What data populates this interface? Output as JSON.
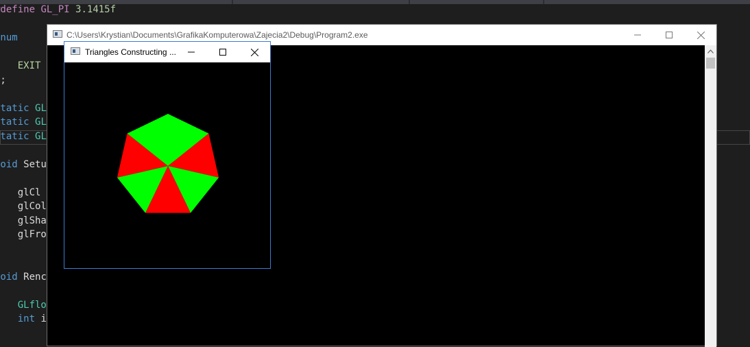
{
  "editor": {
    "lines": [
      {
        "segs": [
          {
            "t": "#define ",
            "c": "mac"
          },
          {
            "t": "GL_PI",
            "c": "mac"
          },
          {
            "t": " ",
            "c": ""
          },
          {
            "t": "3.1415f",
            "c": "num"
          }
        ]
      },
      {
        "segs": []
      },
      {
        "segs": [
          {
            "t": "enum",
            "c": "kw"
          }
        ]
      },
      {
        "segs": [
          {
            "t": "{",
            "c": ""
          }
        ]
      },
      {
        "segs": [
          {
            "t": "    ",
            "c": ""
          },
          {
            "t": "EXIT",
            "c": "en"
          }
        ]
      },
      {
        "segs": [
          {
            "t": "};",
            "c": ""
          }
        ]
      },
      {
        "segs": []
      },
      {
        "segs": [
          {
            "t": "static ",
            "c": "kw"
          },
          {
            "t": "GL",
            "c": "ty"
          }
        ]
      },
      {
        "segs": [
          {
            "t": "static ",
            "c": "kw"
          },
          {
            "t": "GL",
            "c": "ty"
          }
        ]
      },
      {
        "segs": [
          {
            "t": "static ",
            "c": "kw"
          },
          {
            "t": "GL",
            "c": "ty"
          }
        ]
      },
      {
        "segs": []
      },
      {
        "segs": [
          {
            "t": "void ",
            "c": "kw"
          },
          {
            "t": "Setu",
            "c": ""
          }
        ]
      },
      {
        "segs": [
          {
            "t": "{",
            "c": ""
          }
        ]
      },
      {
        "segs": [
          {
            "t": "    glCl",
            "c": ""
          }
        ]
      },
      {
        "segs": [
          {
            "t": "    glCol",
            "c": ""
          }
        ]
      },
      {
        "segs": [
          {
            "t": "    glSha",
            "c": ""
          }
        ]
      },
      {
        "segs": [
          {
            "t": "    glFro",
            "c": ""
          }
        ]
      },
      {
        "segs": [
          {
            "t": "}",
            "c": ""
          }
        ]
      },
      {
        "segs": []
      },
      {
        "segs": [
          {
            "t": "void ",
            "c": "kw"
          },
          {
            "t": "Renc",
            "c": ""
          }
        ]
      },
      {
        "segs": [
          {
            "t": "{",
            "c": ""
          }
        ]
      },
      {
        "segs": [
          {
            "t": "    ",
            "c": ""
          },
          {
            "t": "GLflo",
            "c": "ty"
          }
        ]
      },
      {
        "segs": [
          {
            "t": "    ",
            "c": ""
          },
          {
            "t": "int",
            "c": "kw"
          },
          {
            "t": " i",
            "c": ""
          }
        ]
      }
    ]
  },
  "console_window": {
    "title": "C:\\Users\\Krystian\\Documents\\GrafikaKomputerowa\\Zajecia2\\Debug\\Program2.exe",
    "icon": "console-app-icon"
  },
  "gl_window": {
    "title": "Triangles Constructing ...",
    "icon": "gl-app-icon",
    "heptagon": {
      "sides": 7,
      "colors": [
        "#00ff00",
        "#ff0000"
      ],
      "fan_colors": [
        "#00ff00",
        "#ff0000",
        "#00ff00",
        "#ff0000",
        "#00ff00",
        "#ff0000",
        "#00ff00"
      ]
    }
  },
  "colors": {
    "editor_bg": "#1e1e1e",
    "accent_border": "#3b7bd6"
  }
}
